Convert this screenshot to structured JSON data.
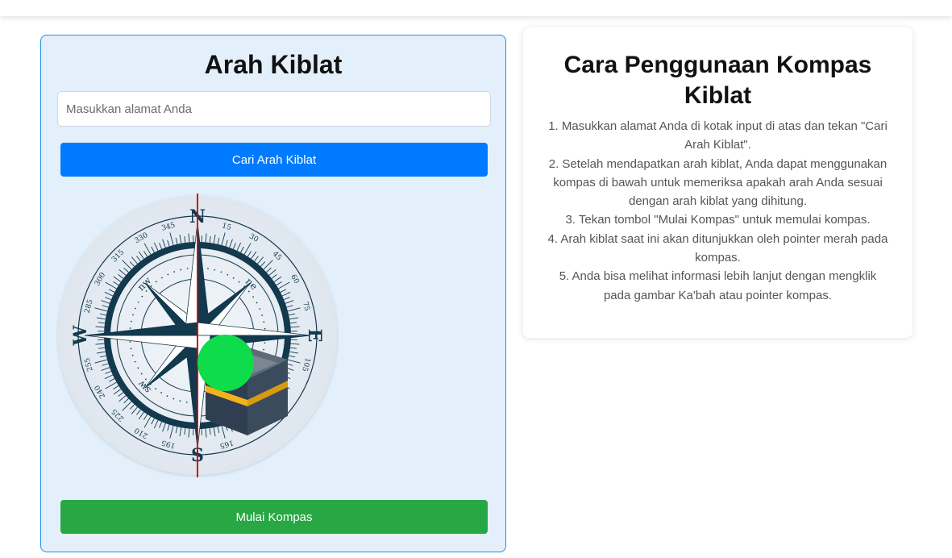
{
  "left_panel": {
    "title": "Arah Kiblat",
    "address_input": {
      "placeholder": "Masukkan alamat Anda",
      "value": ""
    },
    "search_button": "Cari Arah Kiblat",
    "start_button": "Mulai Kompas"
  },
  "compass": {
    "cardinals": {
      "n": "N",
      "e": "E",
      "s": "S",
      "w": "W"
    },
    "intercardinals": {
      "ne": "ne",
      "nw": "nw",
      "sw": "sw"
    },
    "degree_labels": [
      "15",
      "30",
      "45",
      "60",
      "75",
      "105",
      "165",
      "195",
      "210",
      "225",
      "240",
      "255",
      "285",
      "300",
      "315",
      "330",
      "345"
    ],
    "pointer_color": "#cc0000",
    "marker_color": "#0fdc4a",
    "dark_color": "#12394d"
  },
  "right_panel": {
    "title": "Cara Penggunaan Kompas Kiblat",
    "steps": [
      "1. Masukkan alamat Anda di kotak input di atas dan tekan \"Cari Arah Kiblat\".",
      "2. Setelah mendapatkan arah kiblat, Anda dapat menggunakan kompas di bawah untuk memeriksa apakah arah Anda sesuai dengan arah kiblat yang dihitung.",
      "3. Tekan tombol \"Mulai Kompas\" untuk memulai kompas.",
      "4. Arah kiblat saat ini akan ditunjukkan oleh pointer merah pada kompas.",
      "5. Anda bisa melihat informasi lebih lanjut dengan mengklik pada gambar Ka'bah atau pointer kompas."
    ]
  }
}
